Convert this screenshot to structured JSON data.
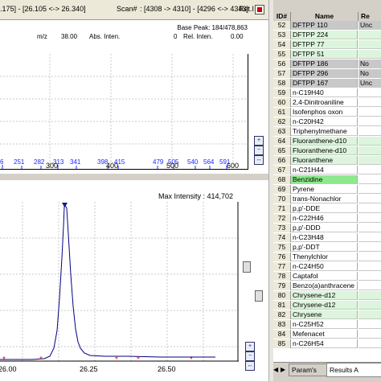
{
  "status_bar": {
    "ret_range": ".175] - [26.105 <-> 26.340]",
    "scan_label": "Scan#",
    "scan_range": ": [4308 -> 4310] - [4296 <-> 4343]",
    "ret_label": "Ret.I"
  },
  "spectrum": {
    "base_peak": "Base Peak: 184/478,863",
    "mz_label": "m/z",
    "mz_value": "38.00",
    "abs_label": "Abs. Inten.",
    "abs_value": "0",
    "rel_label": "Rel. Inten.",
    "rel_value": "0.00",
    "peaks": [
      "6",
      "251",
      "282",
      "313",
      "341",
      "398",
      "415",
      "479",
      "505",
      "540",
      "564",
      "591"
    ],
    "x_ticks": [
      "300",
      "400",
      "500",
      "600"
    ]
  },
  "chromatogram": {
    "max_intensity": "Max Intensity : 414,702",
    "x_ticks": [
      "26.00",
      "26.25",
      "26.50"
    ],
    "colors": {
      "trace": "#000080",
      "marker": "#ff0000",
      "peak_top": "#1a1a80"
    }
  },
  "table": {
    "headers": {
      "id": "ID#",
      "name": "Name",
      "result": "Re"
    },
    "rows": [
      {
        "id": "52",
        "name": "DFTPP 110",
        "result": "Unc",
        "style": "gray"
      },
      {
        "id": "53",
        "name": "DFTPP 224",
        "result": "",
        "style": "green"
      },
      {
        "id": "54",
        "name": "DFTPP 77",
        "result": "",
        "style": "green"
      },
      {
        "id": "55",
        "name": "DFTPP 51",
        "result": "",
        "style": "green"
      },
      {
        "id": "56",
        "name": "DFTPP 186",
        "result": "No",
        "style": "gray"
      },
      {
        "id": "57",
        "name": "DFTPP 296",
        "result": "No",
        "style": "gray"
      },
      {
        "id": "58",
        "name": "DFTPP 167",
        "result": "Unc",
        "style": "gray"
      },
      {
        "id": "59",
        "name": "n-C19H40",
        "result": "",
        "style": "white"
      },
      {
        "id": "60",
        "name": "2,4-Dinitroaniline",
        "result": "",
        "style": "white"
      },
      {
        "id": "61",
        "name": "Isofenphos oxon",
        "result": "",
        "style": "white"
      },
      {
        "id": "62",
        "name": "n-C20H42",
        "result": "",
        "style": "white"
      },
      {
        "id": "63",
        "name": "Triphenylmethane",
        "result": "",
        "style": "white"
      },
      {
        "id": "64",
        "name": "Fluoranthene-d10",
        "result": "",
        "style": "green"
      },
      {
        "id": "65",
        "name": "Fluoranthene-d10",
        "result": "",
        "style": "green"
      },
      {
        "id": "66",
        "name": "Fluoranthene",
        "result": "",
        "style": "green"
      },
      {
        "id": "67",
        "name": "n-C21H44",
        "result": "",
        "style": "white"
      },
      {
        "id": "68",
        "name": "Benzidine",
        "result": "",
        "style": "selected"
      },
      {
        "id": "69",
        "name": "Pyrene",
        "result": "",
        "style": "white"
      },
      {
        "id": "70",
        "name": "trans-Nonachlor",
        "result": "",
        "style": "white"
      },
      {
        "id": "71",
        "name": "p,p'-DDE",
        "result": "",
        "style": "white"
      },
      {
        "id": "72",
        "name": "n-C22H46",
        "result": "",
        "style": "white"
      },
      {
        "id": "73",
        "name": "p,p'-DDD",
        "result": "",
        "style": "white"
      },
      {
        "id": "74",
        "name": "n-C23H48",
        "result": "",
        "style": "white"
      },
      {
        "id": "75",
        "name": "p,p'-DDT",
        "result": "",
        "style": "white"
      },
      {
        "id": "76",
        "name": "Thenylchlor",
        "result": "",
        "style": "white"
      },
      {
        "id": "77",
        "name": "n-C24H50",
        "result": "",
        "style": "white"
      },
      {
        "id": "78",
        "name": "Captafol",
        "result": "",
        "style": "white"
      },
      {
        "id": "79",
        "name": "Benzo(a)anthracene",
        "result": "",
        "style": "white"
      },
      {
        "id": "80",
        "name": "Chrysene-d12",
        "result": "",
        "style": "green"
      },
      {
        "id": "81",
        "name": "Chrysene-d12",
        "result": "",
        "style": "green"
      },
      {
        "id": "82",
        "name": "Chrysene",
        "result": "",
        "style": "green"
      },
      {
        "id": "83",
        "name": "n-C25H52",
        "result": "",
        "style": "white"
      },
      {
        "id": "84",
        "name": "Mefenacet",
        "result": "",
        "style": "white"
      },
      {
        "id": "85",
        "name": "n-C26H54",
        "result": "",
        "style": "white"
      }
    ],
    "tabs": [
      {
        "label": "Param's"
      },
      {
        "label": "Results A"
      }
    ]
  }
}
